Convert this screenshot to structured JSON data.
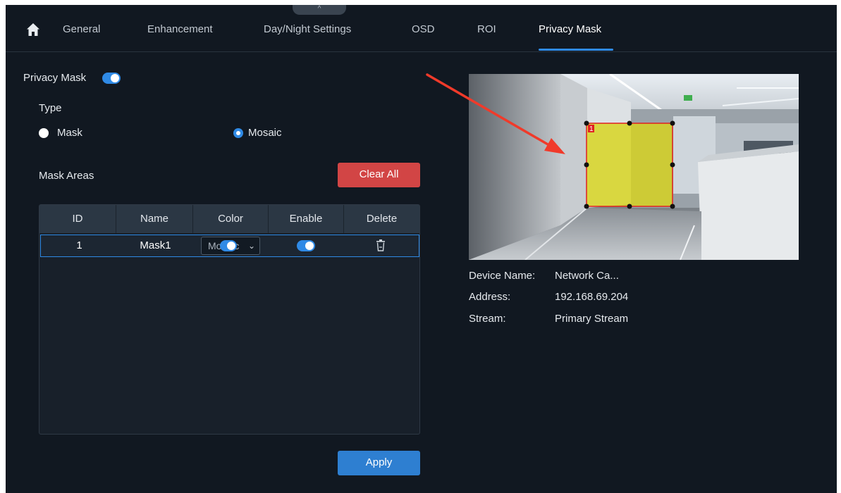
{
  "nav": {
    "handle_glyph": "^",
    "home_icon": "home-icon",
    "tabs": [
      {
        "label": "General"
      },
      {
        "label": "Enhancement"
      },
      {
        "label": "Day/Night Settings"
      },
      {
        "label": "OSD"
      },
      {
        "label": "ROI"
      },
      {
        "label": "Privacy Mask"
      }
    ],
    "active_tab": "Privacy Mask",
    "accent_color": "#2f8ae6"
  },
  "privacy": {
    "label": "Privacy Mask",
    "enabled": true,
    "type_label": "Type",
    "type_options": [
      "Mask",
      "Mosaic"
    ],
    "selected_type": "Mosaic",
    "areas_label": "Mask Areas",
    "clear_all_label": "Clear All",
    "apply_label": "Apply"
  },
  "table": {
    "columns": [
      "ID",
      "Name",
      "Color",
      "Enable",
      "Delete"
    ],
    "rows": [
      {
        "id": "1",
        "name": "Mask1",
        "color": "Mosaic",
        "enabled": true,
        "delete_icon": "trash-icon"
      }
    ]
  },
  "preview": {
    "mask_label": "1",
    "mask_color": "#d8d41c",
    "mask_border_color": "#e02020"
  },
  "device": {
    "name_key": "Device Name:",
    "name_value": "Network Ca...",
    "address_key": "Address:",
    "address_value": "192.168.69.204",
    "stream_key": "Stream:",
    "stream_value": "Primary Stream"
  },
  "annotation": {
    "arrow_color": "#f03a2a"
  }
}
